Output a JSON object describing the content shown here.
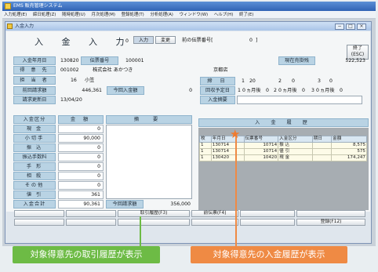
{
  "app": {
    "window_title": "EMS 販売管理システム",
    "menu": [
      "入力処理(E)",
      "締日処理(Z)",
      "随時処理(U)",
      "月次処理(M)",
      "登録処理(T)",
      "分析処理(A)",
      "ウィンドウ(W)",
      "ヘルプ(H)",
      "終了(E)"
    ]
  },
  "inner_window": {
    "title": "入金入力",
    "win_buttons": [
      "−",
      "□",
      "×"
    ]
  },
  "form": {
    "screen_title": "入 金 入 力",
    "mode_value": "0",
    "mode_buttons": [
      "入力",
      "変更"
    ],
    "prev_slip_label": "前の伝票番号[",
    "prev_slip_value": "0",
    "prev_slip_close": "]",
    "close_button": [
      "終了",
      "(ESC)"
    ],
    "entry_date_label": "入金年月日",
    "entry_date": "130820",
    "slip_no_label": "伝票番号",
    "slip_no": "100001",
    "balance_label": "現在売掛残",
    "balance": "522,523",
    "customer_label": "得 意 先",
    "customer_code": "001002",
    "customer_name": "株式会社 あかつき",
    "customer_city": "京都店",
    "staff_label": "担 当 者",
    "staff_code": "16",
    "staff_name": "小笠",
    "closing_label": "締 日",
    "closing": [
      {
        "n": "1",
        "v": "20"
      },
      {
        "n": "2",
        "v": "0"
      },
      {
        "n": "3",
        "v": "0"
      }
    ],
    "prev_billing_label": "前回請求額",
    "prev_billing": "446,361",
    "this_payment_label": "今回入金額",
    "this_payment": "0",
    "collection_label": "回収予定日",
    "collection": [
      {
        "n": "1",
        "months": "0",
        "unit": "ヵ月後",
        "day": "0"
      },
      {
        "n": "2",
        "months": "0",
        "unit": "ヵ月後",
        "day": "0"
      },
      {
        "n": "3",
        "months": "0",
        "unit": "ヵ月後",
        "day": "0"
      }
    ],
    "billing_update_label": "請求更新日",
    "billing_update": "13/04/20",
    "payment_note_label": "入金摘要"
  },
  "payments": {
    "headers": [
      "入金区分",
      "金 額",
      "摘 要"
    ],
    "rows": [
      {
        "label": "現 金",
        "amount": "0"
      },
      {
        "label": "小切手",
        "amount": "90,000"
      },
      {
        "label": "振 込",
        "amount": "0"
      },
      {
        "label": "振込手数料",
        "amount": "0"
      },
      {
        "label": "手 形",
        "amount": "0"
      },
      {
        "label": "相 殺",
        "amount": "0"
      },
      {
        "label": "その他",
        "amount": "0"
      },
      {
        "label": "値 引",
        "amount": "361"
      }
    ],
    "total_label": "入金合計",
    "total": "90,361",
    "this_billing_label": "今回請求額",
    "this_billing": "356,000"
  },
  "history": {
    "title": "入 金 履 歴",
    "headers": [
      "枚",
      "年月日",
      "伝票番号",
      "入金区分",
      "期日",
      "金額"
    ],
    "rows": [
      {
        "no": "1",
        "date": "130714",
        "slip": "10714",
        "type": "振 込",
        "due": "",
        "amount": "8,575"
      },
      {
        "no": "1",
        "date": "130714",
        "slip": "10714",
        "type": "値 引",
        "due": "",
        "amount": "575"
      },
      {
        "no": "1",
        "date": "130420",
        "slip": "10420",
        "type": "現 金",
        "due": "",
        "amount": "174,247"
      }
    ]
  },
  "fkeys": {
    "f3": "取引履歴(F3)",
    "f4": "前伝票(F4)",
    "f12": "登録(F12)"
  },
  "callouts": {
    "left": "対象得意先の取引履歴が表示",
    "right": "対象得意先の入金履歴が表示"
  },
  "colors": {
    "accent_green": "#6dbb45",
    "accent_orange": "#ef8a44",
    "label_blue": "#b9d3e4"
  },
  "icons": [
    "app-icon",
    "window-icon",
    "star-marker"
  ]
}
